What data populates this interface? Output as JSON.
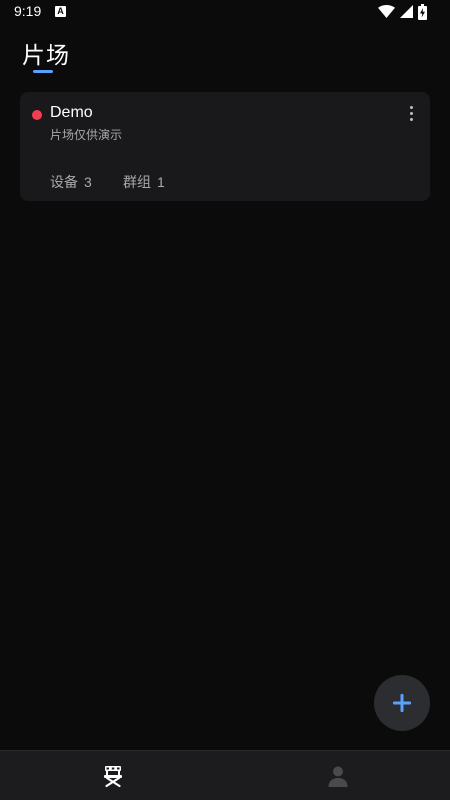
{
  "status_bar": {
    "time": "9:19",
    "notification_icon": "A",
    "icons": [
      "wifi-icon",
      "signal-icon",
      "battery-charging-icon"
    ]
  },
  "header": {
    "title": "片场"
  },
  "studios": [
    {
      "name": "Demo",
      "description": "片场仅供演示",
      "status_color": "#f53c52",
      "devices_label": "设备",
      "devices_count": "3",
      "groups_label": "群组",
      "groups_count": "1"
    }
  ],
  "fab": {
    "icon": "plus-icon",
    "color": "#5aa0ff"
  },
  "bottom_nav": {
    "items": [
      {
        "icon": "director-chair-icon",
        "active": true
      },
      {
        "icon": "person-icon",
        "active": false
      }
    ]
  },
  "colors": {
    "accent": "#5aa0ff",
    "background": "#0b0b0b",
    "card": "#19191b"
  }
}
